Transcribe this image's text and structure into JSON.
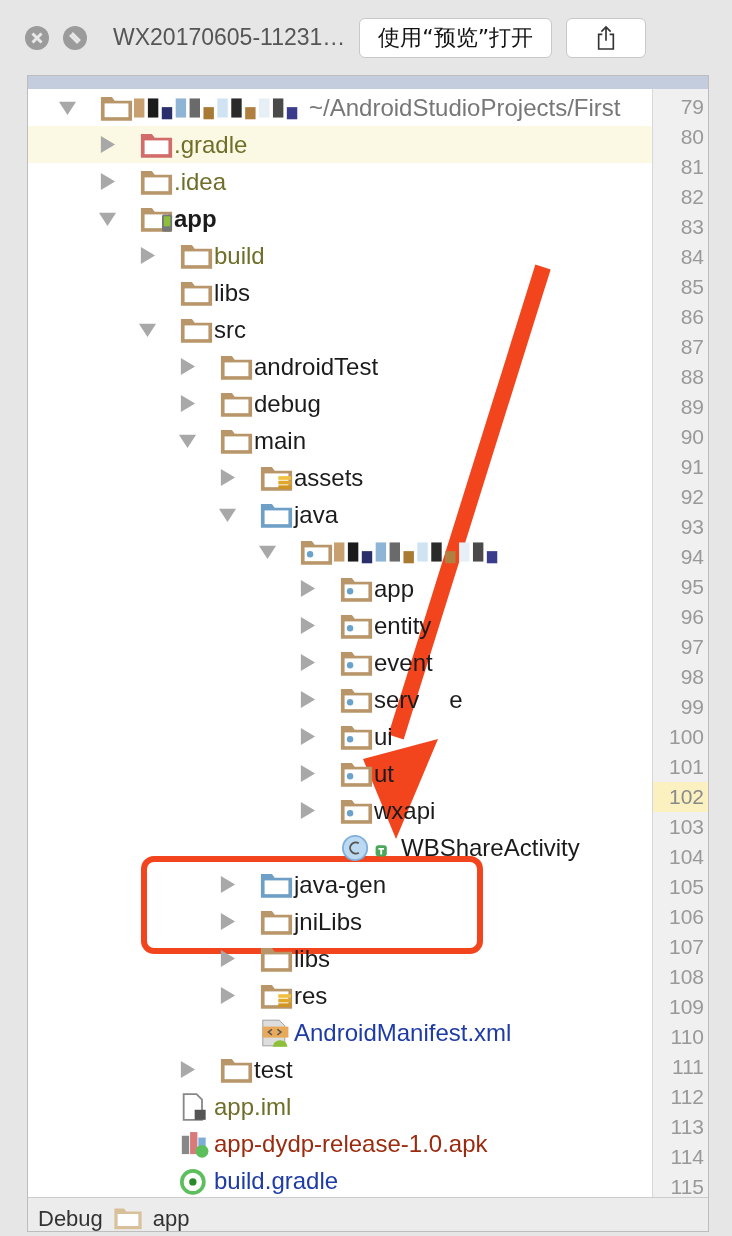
{
  "window": {
    "title": "WX20170605-11231…",
    "open_button": "使用“预览”打开"
  },
  "tree": {
    "label": "~/AndroidStudioProjects/First",
    "kind": "project",
    "expanded": true,
    "selected": false,
    "children": [
      {
        "label": ".gradle",
        "kind": "excluded",
        "color": "#6f6f2a",
        "expanded": false,
        "selected": true
      },
      {
        "label": ".idea",
        "kind": "folder",
        "color": "#6f6f2a",
        "expanded": false,
        "selected": false
      },
      {
        "label": "app",
        "kind": "module",
        "expanded": true,
        "selected": false,
        "children": [
          {
            "label": "build",
            "kind": "folder",
            "color": "#6f6f2a",
            "expanded": false,
            "selected": false
          },
          {
            "label": "libs",
            "kind": "folder",
            "selected": false
          },
          {
            "label": "src",
            "kind": "folder",
            "expanded": true,
            "selected": false,
            "children": [
              {
                "label": "androidTest",
                "kind": "folder",
                "expanded": false,
                "selected": false
              },
              {
                "label": "debug",
                "kind": "folder",
                "expanded": false,
                "selected": false
              },
              {
                "label": "main",
                "kind": "folder",
                "expanded": true,
                "selected": false,
                "children": [
                  {
                    "label": "assets",
                    "kind": "resources",
                    "expanded": false,
                    "selected": false
                  },
                  {
                    "label": "java",
                    "kind": "source",
                    "expanded": true,
                    "selected": false,
                    "children": [
                      {
                        "kind": "package-root",
                        "expanded": true,
                        "selected": false,
                        "children": [
                          {
                            "label": "app",
                            "kind": "package",
                            "expanded": false,
                            "selected": false
                          },
                          {
                            "label": "entity",
                            "kind": "package",
                            "expanded": false,
                            "selected": false
                          },
                          {
                            "label": "event",
                            "kind": "package",
                            "expanded": false,
                            "selected": false
                          },
                          {
                            "label": "serv",
                            "label_tail": "e",
                            "kind": "package",
                            "expanded": false,
                            "selected": false
                          },
                          {
                            "label": "ui",
                            "kind": "package",
                            "expanded": false,
                            "selected": false
                          },
                          {
                            "label": "ut",
                            "kind": "package",
                            "expanded": false,
                            "selected": false
                          },
                          {
                            "label": "wxapi",
                            "kind": "package",
                            "expanded": false,
                            "selected": false
                          },
                          {
                            "label": "WBShareActivity",
                            "kind": "class",
                            "selected": false
                          }
                        ]
                      }
                    ]
                  },
                  {
                    "label": "java-gen",
                    "kind": "source",
                    "expanded": false,
                    "selected": false
                  },
                  {
                    "label": "jniLibs",
                    "kind": "folder",
                    "expanded": false,
                    "selected": false
                  },
                  {
                    "label": "libs",
                    "kind": "folder",
                    "expanded": false,
                    "selected": false
                  },
                  {
                    "label": "res",
                    "kind": "resources",
                    "expanded": false,
                    "selected": false
                  },
                  {
                    "label": "AndroidManifest.xml",
                    "kind": "manifest",
                    "color": "#1f3ca6",
                    "selected": false
                  }
                ]
              },
              {
                "label": "test",
                "kind": "folder",
                "expanded": false,
                "selected": false
              }
            ]
          },
          {
            "label": "app.iml",
            "kind": "iml",
            "color": "#6f6f2a",
            "selected": false
          },
          {
            "label": "app-dydp-release-1.0.apk",
            "kind": "apk",
            "color": "#9a2b0e",
            "selected": false
          },
          {
            "label": "build.gradle",
            "kind": "gradle",
            "color": "#1f3ca6",
            "selected": false
          }
        ]
      }
    ]
  },
  "line_numbers": [
    {
      "number": "79",
      "current": false
    },
    {
      "number": "80",
      "current": false
    },
    {
      "number": "81",
      "current": false
    },
    {
      "number": "82",
      "current": false
    },
    {
      "number": "83",
      "current": false
    },
    {
      "number": "84",
      "current": false
    },
    {
      "number": "85",
      "current": false
    },
    {
      "number": "86",
      "current": false
    },
    {
      "number": "87",
      "current": false
    },
    {
      "number": "88",
      "current": false
    },
    {
      "number": "89",
      "current": false
    },
    {
      "number": "90",
      "current": false
    },
    {
      "number": "91",
      "current": false
    },
    {
      "number": "92",
      "current": false
    },
    {
      "number": "93",
      "current": false
    },
    {
      "number": "94",
      "current": false
    },
    {
      "number": "95",
      "current": false
    },
    {
      "number": "96",
      "current": false
    },
    {
      "number": "97",
      "current": false
    },
    {
      "number": "98",
      "current": false
    },
    {
      "number": "99",
      "current": false
    },
    {
      "number": "100",
      "current": false
    },
    {
      "number": "101",
      "current": false
    },
    {
      "number": "102",
      "current": true
    },
    {
      "number": "103",
      "current": false
    },
    {
      "number": "104",
      "current": false
    },
    {
      "number": "105",
      "current": false
    },
    {
      "number": "106",
      "current": false
    },
    {
      "number": "107",
      "current": false
    },
    {
      "number": "108",
      "current": false
    },
    {
      "number": "109",
      "current": false
    },
    {
      "number": "110",
      "current": false
    },
    {
      "number": "111",
      "current": false
    },
    {
      "number": "112",
      "current": false
    },
    {
      "number": "113",
      "current": false
    },
    {
      "number": "114",
      "current": false
    },
    {
      "number": "115",
      "current": false
    }
  ],
  "status_bar": {
    "items": [
      "Debug",
      "app"
    ]
  }
}
